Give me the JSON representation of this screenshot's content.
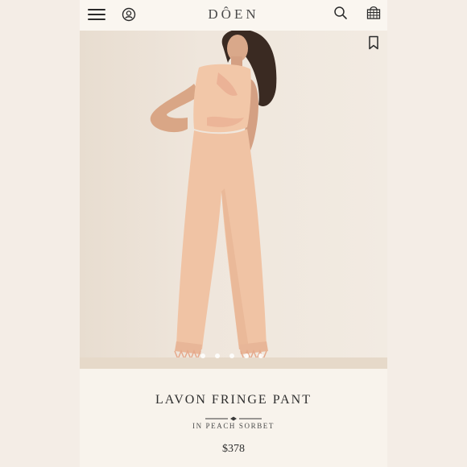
{
  "header": {
    "logo": "DÔEN",
    "menu_icon": "hamburger-menu-icon",
    "account_icon": "account-icon",
    "search_icon": "search-icon",
    "bag_icon": "shopping-basket-icon"
  },
  "product": {
    "name": "LAVON FRINGE PANT",
    "color_line": "IN PEACH SORBET",
    "price": "$378",
    "image_count": 5,
    "active_image": 1,
    "bookmark_icon": "bookmark-icon"
  },
  "colors": {
    "background": "#f3ece4",
    "garment": "#f2c7a8",
    "text": "#2e2e2e"
  }
}
